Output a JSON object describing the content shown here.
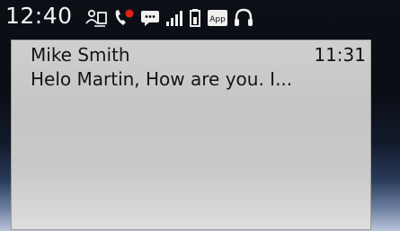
{
  "status_bar": {
    "time": "12:40",
    "icons": [
      "contacts-transfer-icon",
      "missed-call-icon",
      "message-icon",
      "signal-icon",
      "battery-icon",
      "app-icon",
      "headset-icon"
    ],
    "app_icon_text": "App",
    "missed_call_dot_color": "#e0201a"
  },
  "notification": {
    "sender": "Mike Smith",
    "time": "11:31",
    "preview": "Helo Martin, How are you. I..."
  }
}
